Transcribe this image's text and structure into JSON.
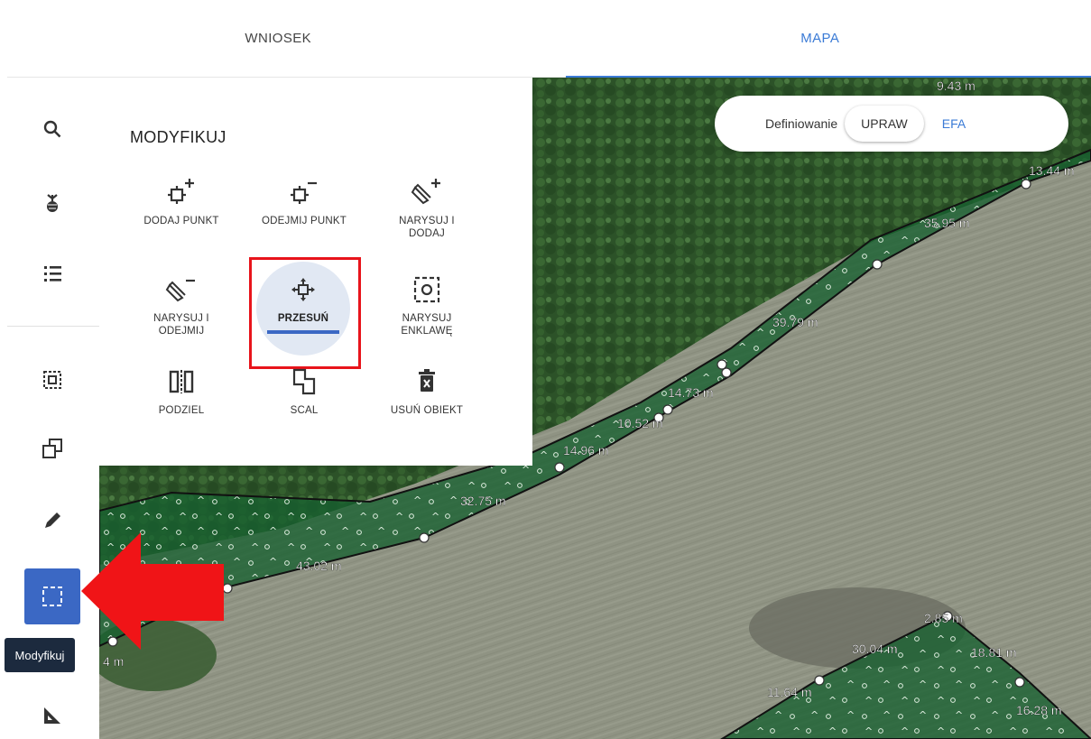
{
  "tabs": [
    {
      "label": "WNIOSEK",
      "active": false
    },
    {
      "label": "MAPA",
      "active": true
    }
  ],
  "sidebar": {
    "items": [
      {
        "icon": "search-icon"
      },
      {
        "icon": "crop-icon"
      },
      {
        "icon": "list-icon"
      },
      {
        "icon": "select-area-icon"
      },
      {
        "icon": "copy-icon"
      },
      {
        "icon": "pencil-icon"
      },
      {
        "icon": "modify-icon",
        "active": true
      },
      {
        "icon": "measure-icon"
      }
    ],
    "tooltip": "Modyfikuj"
  },
  "panel": {
    "title": "MODYFIKUJ",
    "tools": [
      {
        "label": "DODAJ PUNKT",
        "icon": "add-point-icon"
      },
      {
        "label": "ODEJMIJ PUNKT",
        "icon": "remove-point-icon"
      },
      {
        "label": "NARYSUJ I DODAJ",
        "icon": "draw-add-icon"
      },
      {
        "label": "NARYSUJ I ODEJMIJ",
        "icon": "draw-subtract-icon"
      },
      {
        "label": "PRZESUŃ",
        "icon": "move-icon",
        "selected": true
      },
      {
        "label": "NARYSUJ ENKLAWĘ",
        "icon": "enclave-icon"
      },
      {
        "label": "PODZIEL",
        "icon": "split-icon"
      },
      {
        "label": "SCAL",
        "icon": "merge-icon"
      },
      {
        "label": "USUŃ OBIEKT",
        "icon": "delete-icon"
      }
    ]
  },
  "definiowanie": {
    "label": "Definiowanie",
    "upraw": "UPRAW",
    "efa": "EFA"
  },
  "map_labels": [
    "9.43 m",
    "13.44 m",
    "35.95 m",
    "39.79 m",
    "14.73 m",
    "10.52 m",
    "14.96 m",
    "32.75 m",
    "43.02 m",
    "2.85 m",
    "30.04 m",
    "18.81 m",
    "11.64 m",
    "16.28 m",
    "4 m"
  ],
  "colors": {
    "accent": "#3b68c4",
    "tab_active": "#3b7bd6",
    "highlight": "#e8141b",
    "forest": "#2f5a2c",
    "field": "#8d9181",
    "parcel_fill": "#1d5a2c"
  }
}
